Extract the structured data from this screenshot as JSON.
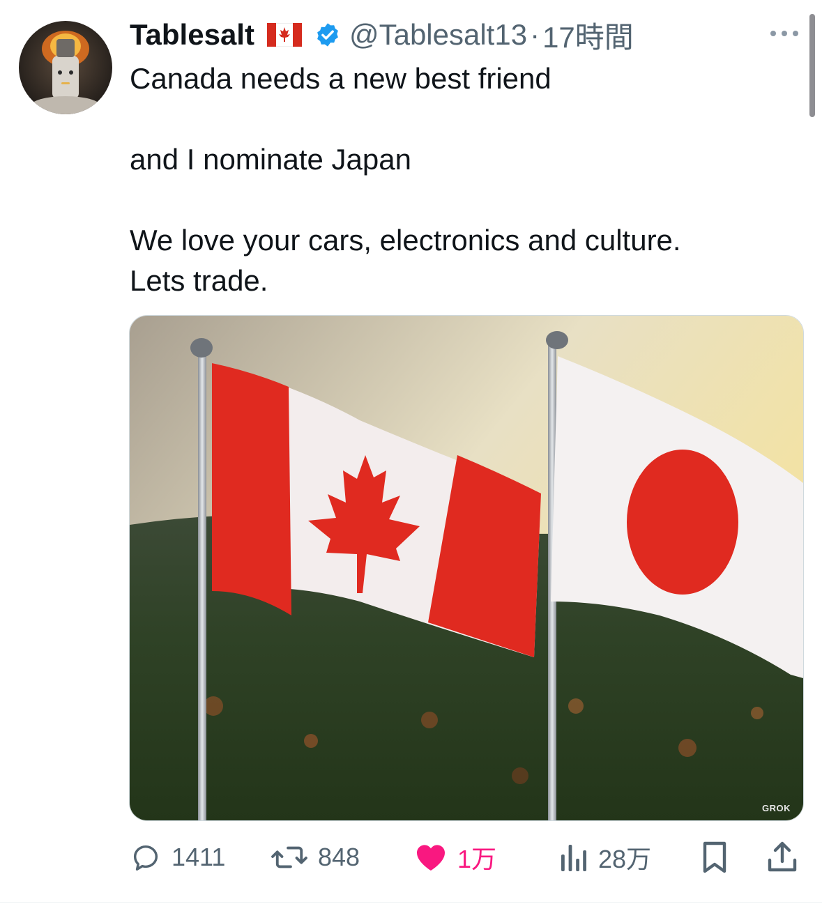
{
  "tweet": {
    "display_name": "Tablesalt",
    "name_flag_emoji": "canadian-flag-emoji",
    "verified": true,
    "handle": "@Tablesalt13",
    "separator": "·",
    "time_ago": "17時間",
    "text_lines": {
      "line1": "Canada needs a new best friend",
      "line2": "and I nominate Japan",
      "line3": "We love your cars, electronics and culture.",
      "line4": "Lets trade."
    },
    "media": {
      "watermark": "GROK"
    }
  },
  "actions": {
    "replies": "1411",
    "reposts": "848",
    "likes": "1万",
    "views": "28万"
  },
  "colors": {
    "text": "#0f1419",
    "secondary": "#536471",
    "like": "#f91880",
    "verified": "#1d9bf0"
  }
}
